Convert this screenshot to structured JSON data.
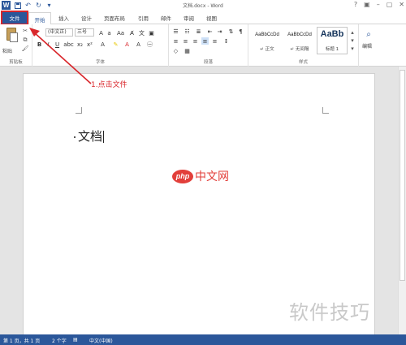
{
  "titlebar": {
    "logo_letter": "W",
    "title": "文档.docx - Word",
    "min": "–",
    "restore": "▢",
    "close": "✕"
  },
  "tabs": {
    "file": "文件",
    "home": "开始",
    "items": [
      "插入",
      "设计",
      "页面布局",
      "引用",
      "邮件",
      "审阅",
      "视图"
    ]
  },
  "ribbon": {
    "paste_label": "粘贴",
    "font_name": "(中文正)",
    "font_size": "三号",
    "groups": {
      "clipboard": "剪贴板",
      "font": "字体",
      "paragraph": "段落",
      "styles": "样式",
      "editing": "编辑"
    },
    "styles": [
      {
        "sample": "AaBbCcDd",
        "name": "↵ 正文"
      },
      {
        "sample": "AaBbCcDd",
        "name": "↵ 无间隔"
      },
      {
        "sample": "AaBb",
        "name": "标题 1"
      }
    ],
    "editing_label": "编辑"
  },
  "document": {
    "text": "文档"
  },
  "annotation": {
    "text": "1.点击文件"
  },
  "watermark": {
    "php": "php",
    "cn": "中文网",
    "bottom": "软件技巧"
  },
  "status": {
    "page": "第 1 页，共 1 页",
    "words": "2 个字",
    "lang": "中文(中国)"
  }
}
